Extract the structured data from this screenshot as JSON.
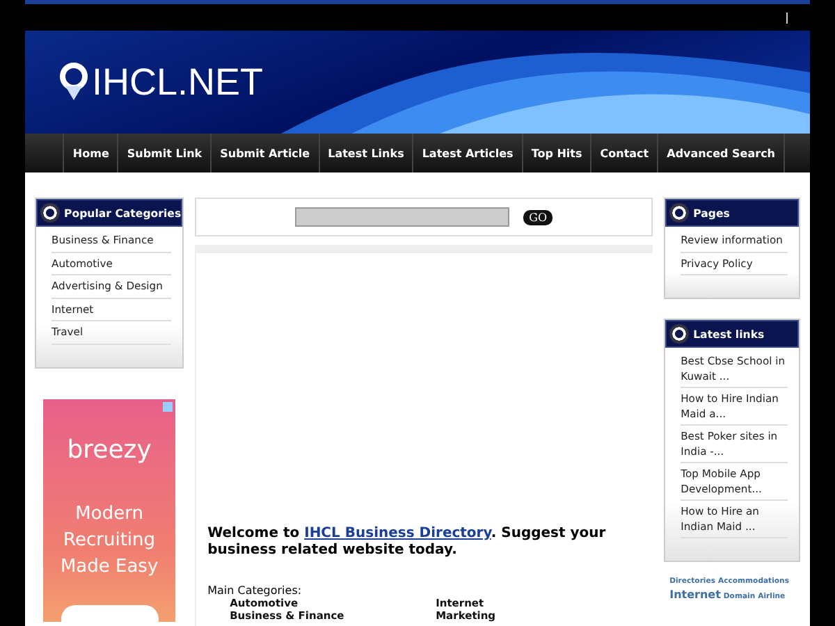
{
  "header": {
    "logo": "IHCL.NET"
  },
  "nav": [
    "Home",
    "Submit Link",
    "Submit Article",
    "Latest Links",
    "Latest Articles",
    "Top Hits",
    "Contact",
    "Advanced Search"
  ],
  "left": {
    "title": "Popular Categories",
    "items": [
      "Business & Finance",
      "Automotive",
      "Advertising & Design",
      "Internet",
      "Travel"
    ]
  },
  "ad": {
    "brand": "breezy",
    "headline": "Modern Recruiting Made Easy"
  },
  "search": {
    "button": "GO"
  },
  "welcome": {
    "before": "Welcome to ",
    "link": "IHCL Business Directory",
    "after": ". Suggest your business related website today."
  },
  "main_categories": {
    "label": "Main Categories:",
    "columns": [
      [
        "Automotive",
        "Business & Finance"
      ],
      [
        "Internet",
        "Marketing"
      ]
    ]
  },
  "pages": {
    "title": "Pages",
    "items": [
      "Review information",
      "Privacy Policy"
    ]
  },
  "latest": {
    "title": "Latest links",
    "items": [
      "Best Cbse School in Kuwait ...",
      "How to Hire Indian Maid a...",
      "Best Poker sites in India -...",
      "Top Mobile App Development...",
      "How to Hire an Indian Maid ..."
    ]
  },
  "tags": [
    {
      "label": "Directories",
      "kind": "small"
    },
    {
      "label": "Accommodations",
      "kind": "small"
    },
    {
      "label": "Internet",
      "kind": "large"
    },
    {
      "label": "Domain",
      "kind": "small"
    },
    {
      "label": "Airline",
      "kind": "small"
    }
  ]
}
